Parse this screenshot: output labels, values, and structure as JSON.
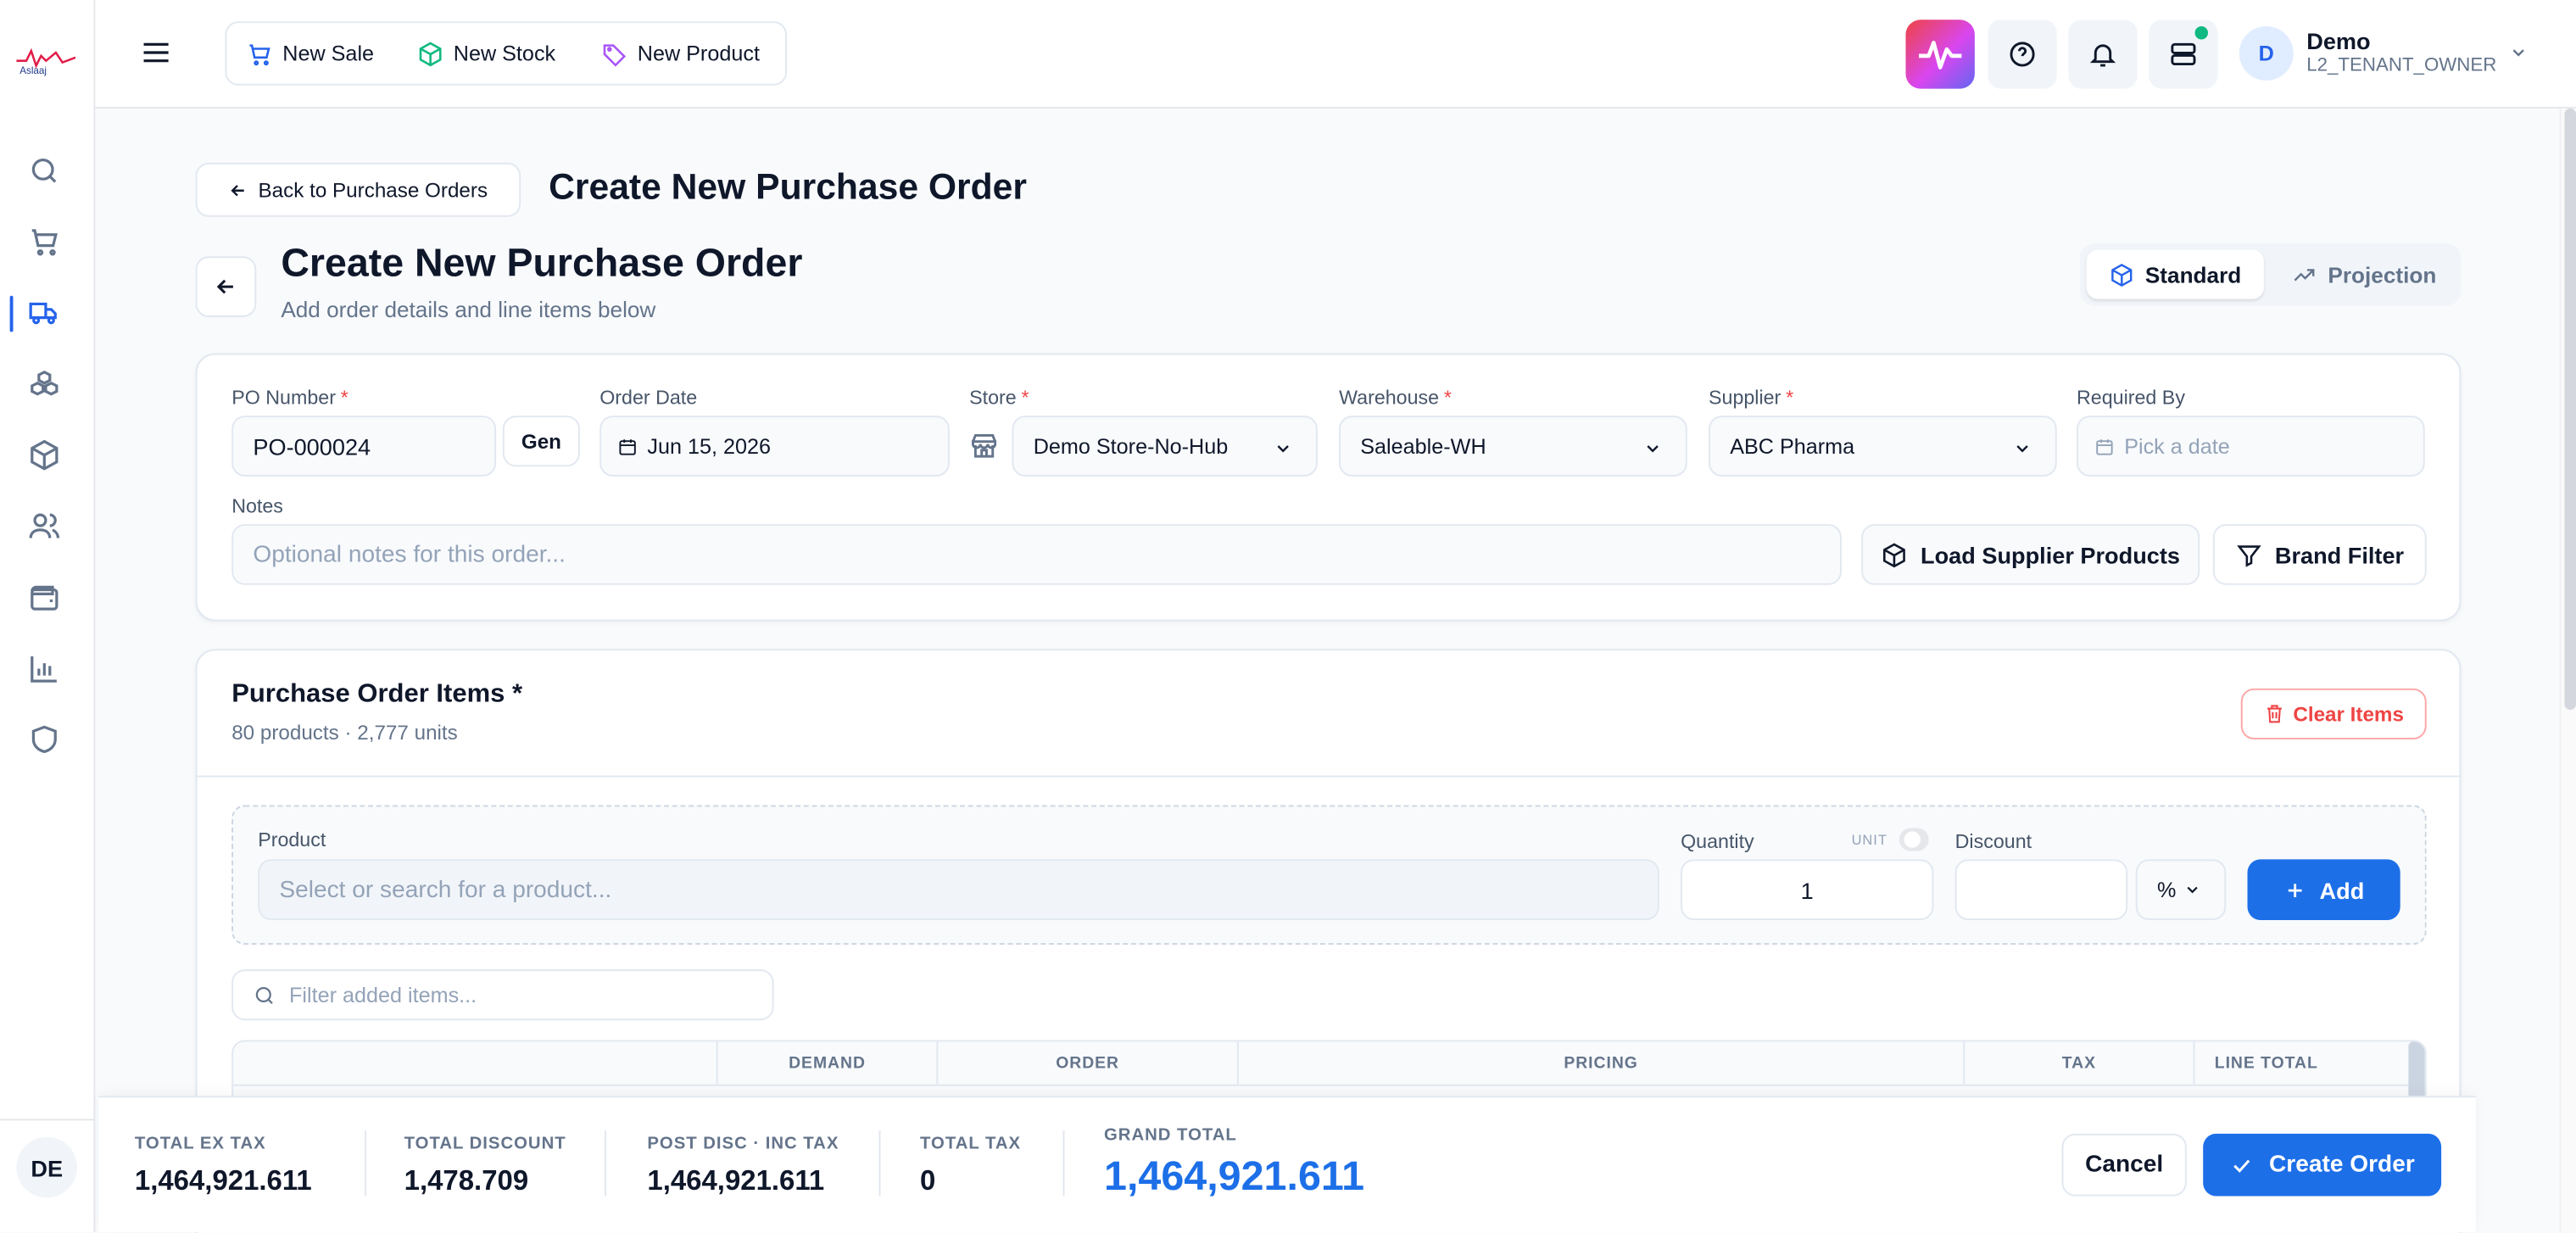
{
  "brand": {
    "logo_text": "Aslaaj"
  },
  "sidebar": {
    "items": [
      "search-icon",
      "cart-icon",
      "truck-icon",
      "boxes-icon",
      "package-icon",
      "users-icon",
      "wallet-icon",
      "chart-icon",
      "shield-icon"
    ],
    "user_initials": "DE"
  },
  "header": {
    "quick_actions": [
      {
        "label": "New Sale",
        "icon": "cart-icon"
      },
      {
        "label": "New Stock",
        "icon": "box-icon"
      },
      {
        "label": "New Product",
        "icon": "tag-icon"
      }
    ],
    "user": {
      "avatar": "D",
      "name": "Demo",
      "role": "L2_TENANT_OWNER"
    }
  },
  "page": {
    "back_label": "Back to Purchase Orders",
    "page_title": "Create New Purchase Order",
    "form_title": "Create New Purchase Order",
    "form_subtitle": "Add order details and line items below",
    "modes": [
      "Standard",
      "Projection"
    ],
    "active_mode": "Standard"
  },
  "form": {
    "po_number_label": "PO Number",
    "po_number_value": "PO-000024",
    "gen_label": "Gen",
    "order_date_label": "Order Date",
    "order_date_value": "Jun 15, 2026",
    "store_label": "Store",
    "store_value": "Demo Store-No-Hub",
    "warehouse_label": "Warehouse",
    "warehouse_value": "Saleable-WH",
    "supplier_label": "Supplier",
    "supplier_value": "ABC Pharma",
    "required_by_label": "Required By",
    "required_by_placeholder": "Pick a date",
    "notes_label": "Notes",
    "notes_placeholder": "Optional notes for this order...",
    "load_supplier_label": "Load Supplier Products",
    "brand_filter_label": "Brand Filter"
  },
  "items": {
    "title": "Purchase Order Items *",
    "summary": "80 products · 2,777 units",
    "clear_label": "Clear Items",
    "product_label": "Product",
    "product_placeholder": "Select or search for a product...",
    "quantity_label": "Quantity",
    "unit_label": "UNIT",
    "quantity_value": "1",
    "discount_label": "Discount",
    "discount_unit": "%",
    "add_label": "Add",
    "filter_placeholder": "Filter added items...",
    "columns": [
      "DEMAND",
      "ORDER",
      "PRICING",
      "TAX",
      "LINE TOTAL"
    ]
  },
  "totals": {
    "total_ex_tax_label": "TOTAL EX TAX",
    "total_ex_tax": "1,464,921.611",
    "total_discount_label": "TOTAL DISCOUNT",
    "total_discount": "1,478.709",
    "post_disc_label": "POST DISC · INC TAX",
    "post_disc": "1,464,921.611",
    "total_tax_label": "TOTAL TAX",
    "total_tax": "0",
    "grand_total_label": "GRAND TOTAL",
    "grand_total": "1,464,921.611",
    "cancel_label": "Cancel",
    "create_label": "Create Order"
  },
  "colors": {
    "accent": "#1d6fe8",
    "danger": "#ef4444",
    "notification": "#10b981"
  }
}
